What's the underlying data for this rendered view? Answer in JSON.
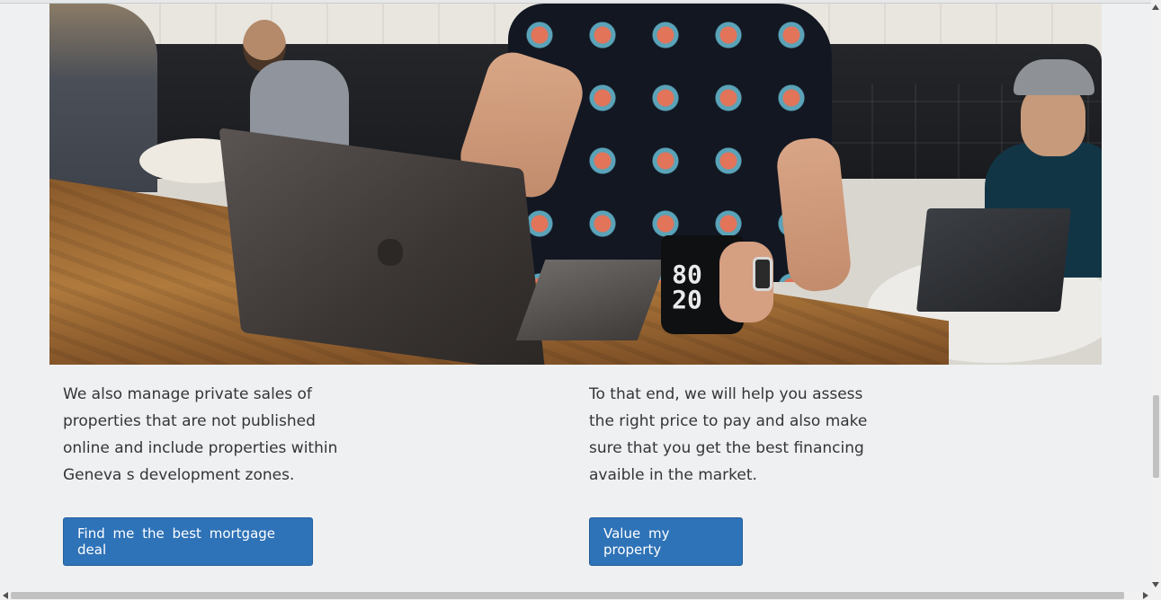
{
  "hero_image": {
    "description_icon": "photo-cafe-laptop",
    "mug_text": "80\n20"
  },
  "columns": [
    {
      "text": "We also manage private sales of properties that are not published online and include properties within Geneva s development zones.",
      "button_label": "Find me the best mortgage deal"
    },
    {
      "text": "To that end, we will help you assess the right price to pay and also make sure that you get the best financing avaible in the market.",
      "button_label": "Value my property"
    }
  ],
  "colors": {
    "page_background": "#eef0f1",
    "button_primary": "#2e72b7",
    "button_text": "#ffffff",
    "body_text": "#333537"
  }
}
